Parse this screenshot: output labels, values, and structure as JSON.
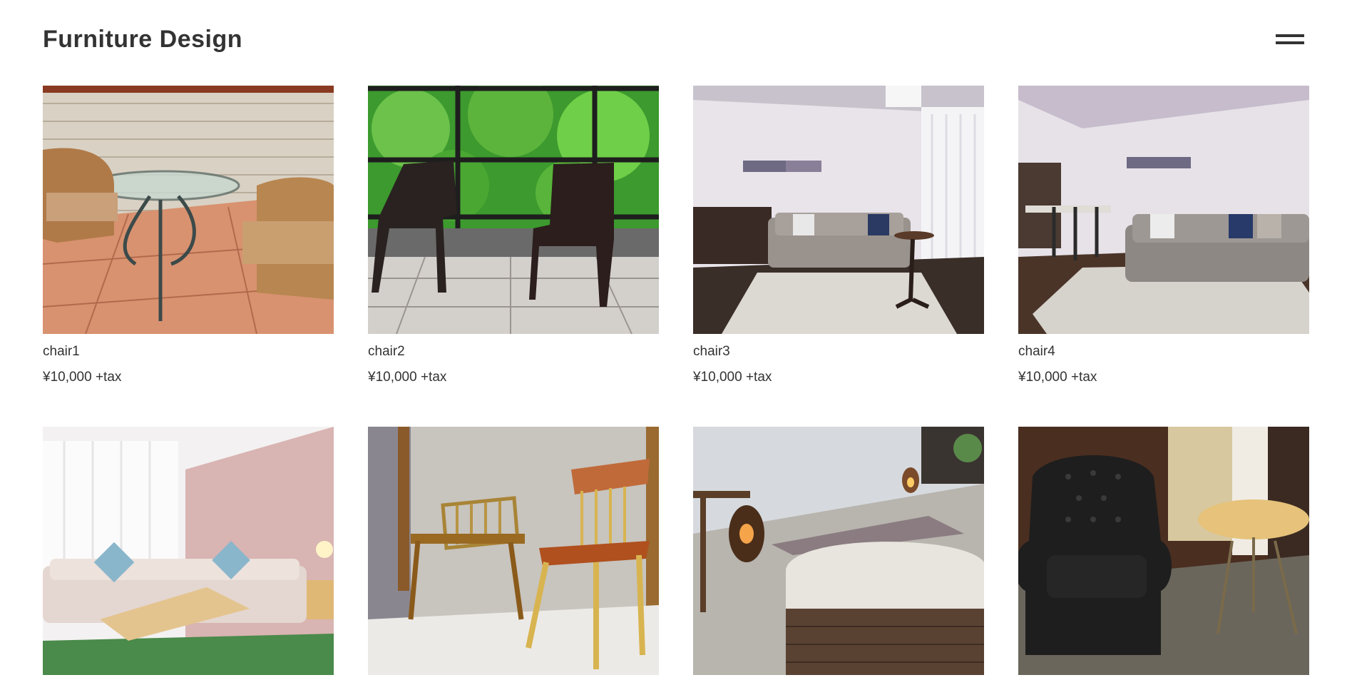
{
  "header": {
    "title": "Furniture Design",
    "menu_icon": "hamburger-menu-icon"
  },
  "products": [
    {
      "name": "chair1",
      "price": "¥10,000 +tax",
      "image": "rattan-chairs-glass-table-photo"
    },
    {
      "name": "chair2",
      "price": "¥10,000 +tax",
      "image": "dining-chairs-forest-window-photo"
    },
    {
      "name": "chair3",
      "price": "¥10,000 +tax",
      "image": "living-room-sofa-rug-photo"
    },
    {
      "name": "chair4",
      "price": "¥10,000 +tax",
      "image": "living-room-sofa-dining-photo"
    },
    {
      "name": "",
      "price": "",
      "image": "pink-room-sofa-table-photo"
    },
    {
      "name": "",
      "price": "",
      "image": "wooden-bench-chair-photo"
    },
    {
      "name": "",
      "price": "",
      "image": "ottoman-lantern-room-photo"
    },
    {
      "name": "",
      "price": "",
      "image": "leather-armchair-round-table-photo"
    }
  ]
}
